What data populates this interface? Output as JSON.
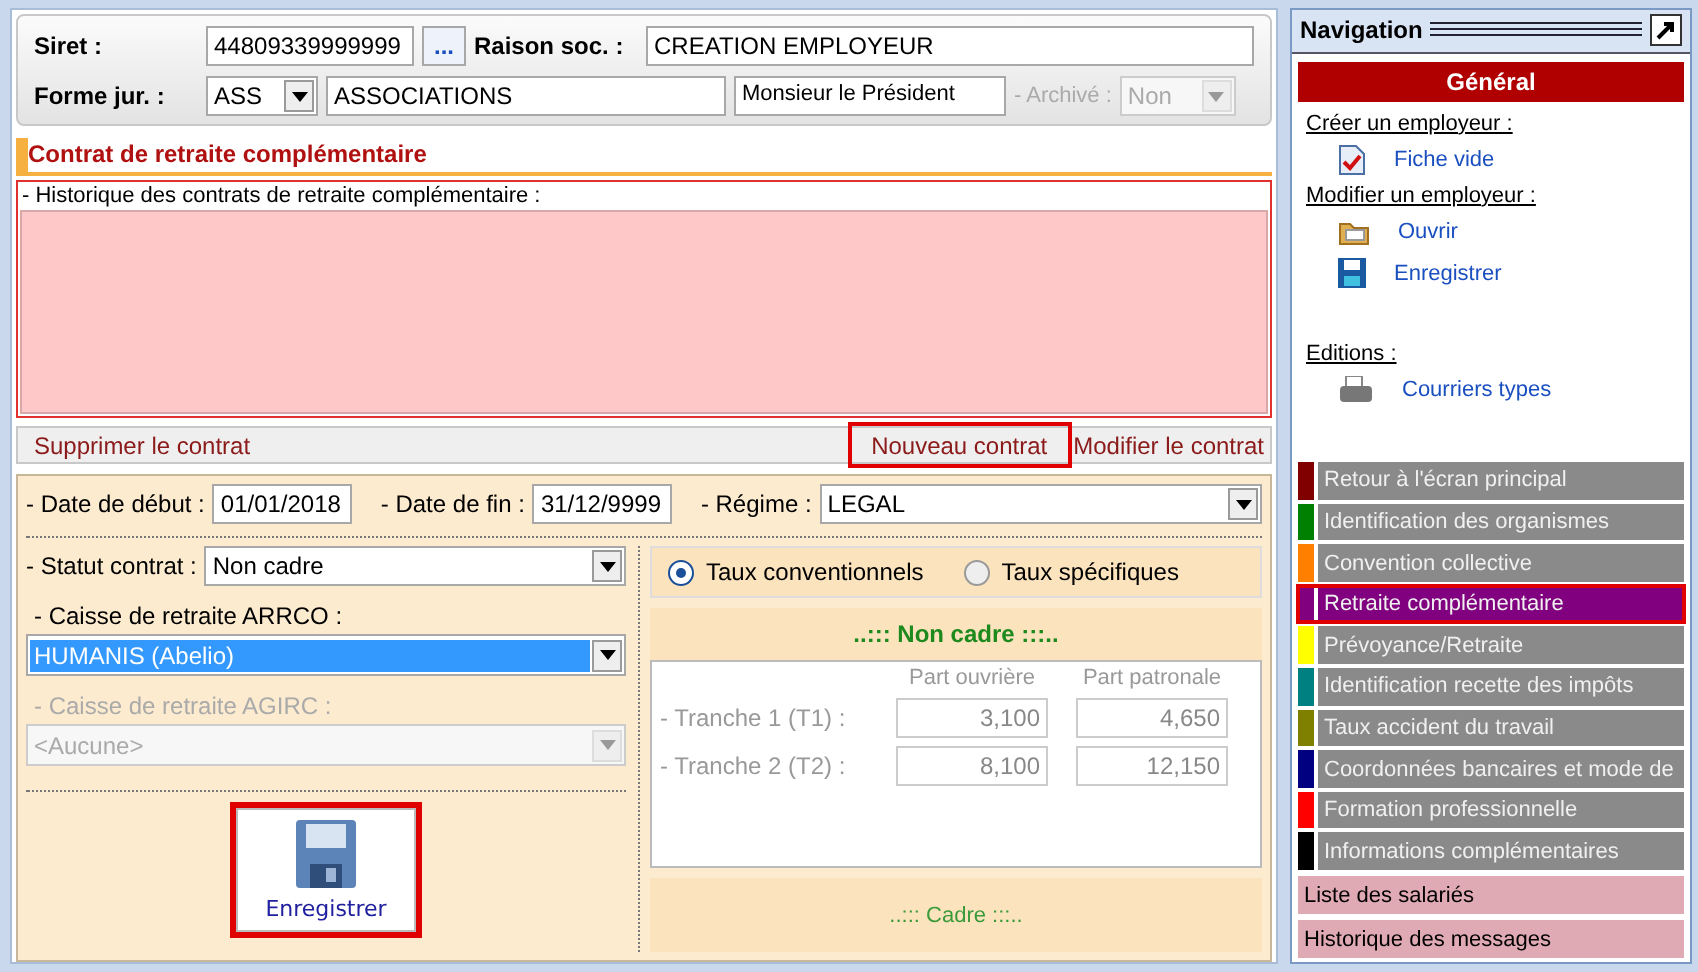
{
  "header": {
    "siret_label": "Siret :",
    "siret": "44809339999999",
    "browse": "...",
    "raison_label": "Raison soc. :",
    "raison": "CREATION EMPLOYEUR",
    "forme_label": "Forme jur. :",
    "forme_code": "ASS",
    "forme_name": "ASSOCIATIONS",
    "civilite": "Monsieur le Président",
    "archive_label": "- Archivé :",
    "archive": "Non",
    "archive_disabled": true
  },
  "section_title": "Contrat de retraite complémentaire",
  "history": {
    "label": "- Historique des contrats de retraite complémentaire :"
  },
  "actions": [
    {
      "label": "Supprimer le contrat",
      "highlighted": false
    },
    {
      "label": "Nouveau contrat",
      "highlighted": true
    },
    {
      "label": "Modifier le contrat",
      "highlighted": false
    }
  ],
  "form": {
    "debut_label": "- Date de début :",
    "debut": "01/01/2018",
    "fin_label": "- Date de fin :",
    "fin": "31/12/9999",
    "regime_label": "- Régime :",
    "regime": "LEGAL",
    "statut_label": "- Statut contrat :",
    "statut": "Non cadre",
    "arrco_label": "- Caisse de retraite ARRCO :",
    "arrco": "HUMANIS (Abelio)",
    "arrco_disabled": false,
    "agirc_label": "- Caisse de retraite AGIRC :",
    "agirc": "<Aucune>",
    "agirc_disabled": true,
    "save": {
      "label": "Enregistrer",
      "highlighted": true
    }
  },
  "rates": {
    "options": [
      {
        "label": "Taux conventionnels",
        "selected": true
      },
      {
        "label": "Taux spécifiques",
        "selected": false
      }
    ],
    "title": "..::: Non cadre :::..",
    "columns": [
      "Part ouvrière",
      "Part patronale"
    ],
    "rows": [
      {
        "label": "- Tranche 1 (T1) :",
        "values": [
          "3,100",
          "4,650"
        ]
      },
      {
        "label": "- Tranche 2 (T2) :",
        "values": [
          "8,100",
          "12,150"
        ]
      }
    ],
    "footer": "..::: Cadre :::.."
  },
  "navigation": {
    "title": "Navigation",
    "group": "Général",
    "sections": [
      {
        "heading": "Créer un employeur :",
        "links": [
          {
            "label": "Fiche vide",
            "kind": "document"
          }
        ]
      },
      {
        "heading": "Modifier un employeur :",
        "links": [
          {
            "label": "Ouvrir",
            "kind": "folder"
          },
          {
            "label": "Enregistrer",
            "kind": "disk"
          }
        ]
      },
      {
        "heading": "Editions :",
        "links": [
          {
            "label": "Courriers types",
            "kind": "printer"
          }
        ]
      }
    ],
    "items": [
      {
        "label": "Retour à l'écran principal",
        "color": "#800000",
        "selected": false,
        "highlighted": false
      },
      {
        "label": "Identification des organismes",
        "color": "#008000",
        "selected": false,
        "highlighted": false
      },
      {
        "label": "Convention collective",
        "color": "#ff8000",
        "selected": false,
        "highlighted": false
      },
      {
        "label": "Retraite complémentaire",
        "color": "#800080",
        "selected": true,
        "highlighted": true
      },
      {
        "label": "Prévoyance/Retraite",
        "color": "#ffff00",
        "selected": false,
        "highlighted": false
      },
      {
        "label": "Identification recette des impôts",
        "color": "#008080",
        "selected": false,
        "highlighted": false
      },
      {
        "label": "Taux accident du travail",
        "color": "#808000",
        "selected": false,
        "highlighted": false
      },
      {
        "label": "Coordonnées bancaires et mode de",
        "color": "#000080",
        "selected": false,
        "highlighted": false
      },
      {
        "label": "Formation professionnelle",
        "color": "#ff0000",
        "selected": false,
        "highlighted": false
      },
      {
        "label": "Informations complémentaires",
        "color": "#000000",
        "selected": false,
        "highlighted": false
      }
    ],
    "extra": [
      "Liste des salariés",
      "Historique des messages"
    ]
  }
}
